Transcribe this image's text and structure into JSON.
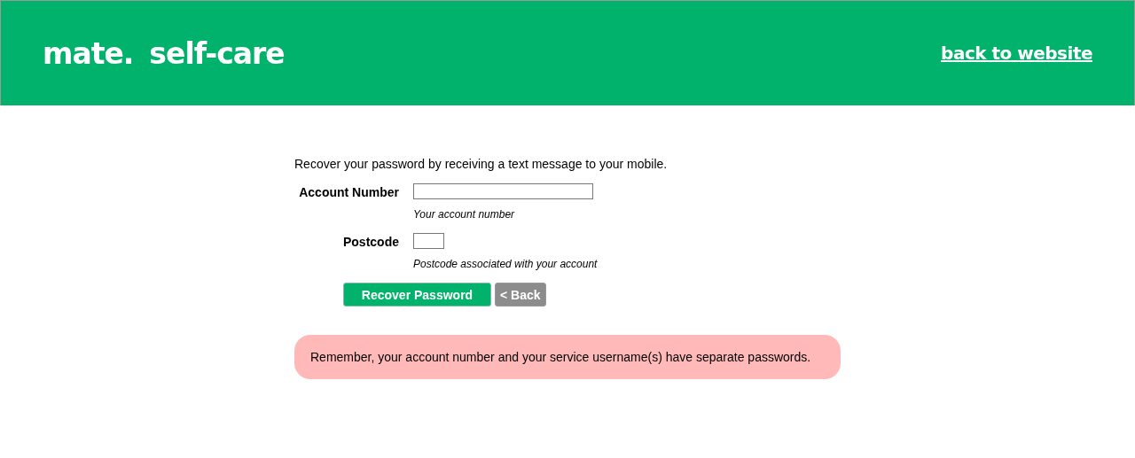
{
  "header": {
    "logo": "mate.",
    "title": "self-care",
    "link": "back to website"
  },
  "intro": "Recover your password by receiving a text message to your mobile.",
  "fields": [
    {
      "label": "Account Number",
      "hint": "Your account number",
      "kind": "wide"
    },
    {
      "label": "Postcode",
      "hint": "Postcode associated with your account",
      "kind": "narrow"
    }
  ],
  "buttons": [
    {
      "label": "Recover Password",
      "kind": "primary"
    },
    {
      "label": "< Back",
      "kind": "secondary"
    }
  ],
  "notice": "Remember, your account number and your service username(s) have separate passwords."
}
